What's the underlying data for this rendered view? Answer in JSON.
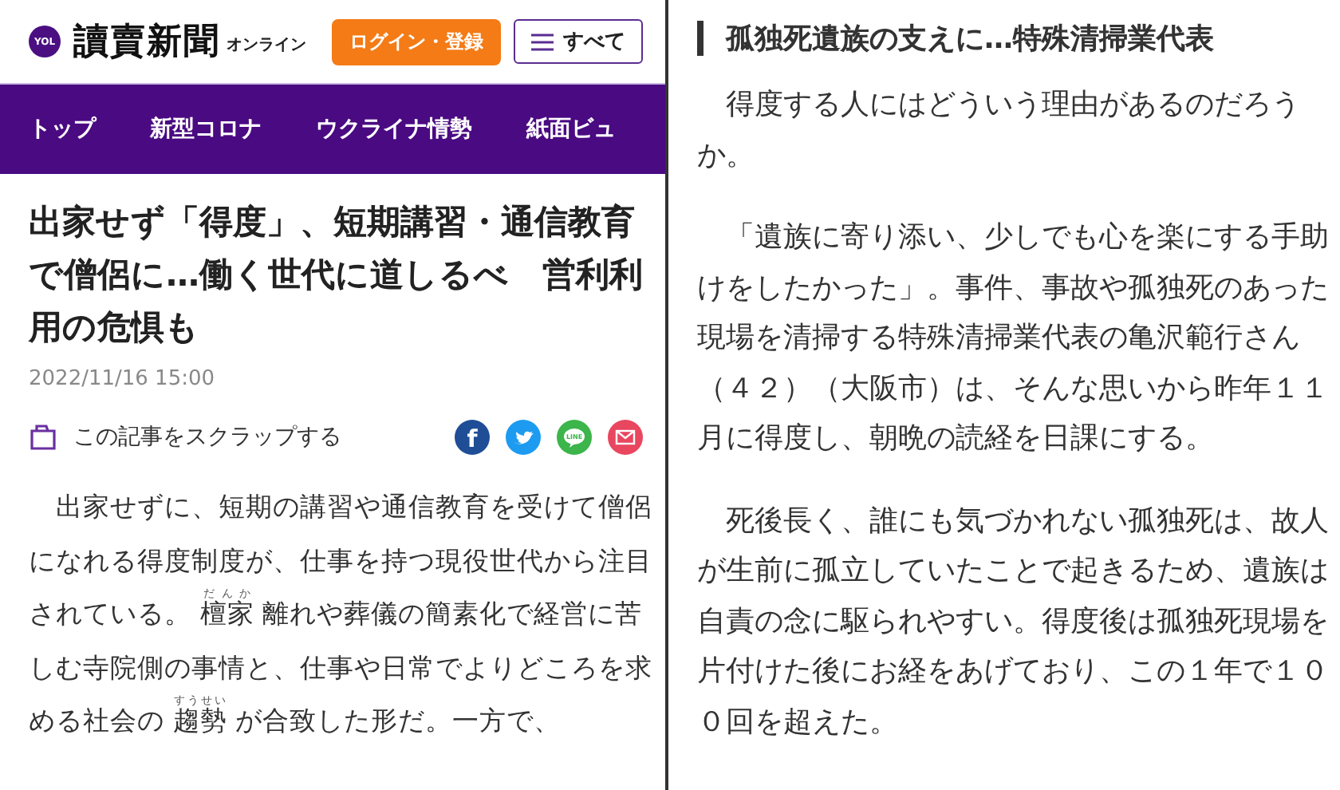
{
  "left": {
    "header": {
      "logo_badge": "YOL",
      "logo": "讀賣新聞",
      "logo_suffix": "オンライン",
      "login_button": "ログイン・登録",
      "menu_button": "すべて"
    },
    "nav": [
      {
        "label": "トップ"
      },
      {
        "label": "新型コロナ"
      },
      {
        "label": "ウクライナ情勢"
      },
      {
        "label": "紙面ビュ"
      }
    ],
    "headline": "出家せず「得度」、短期講習・通信教育で僧侶に…働く世代に道しるべ　営利利用の危惧も",
    "date": "2022/11/16 15:00",
    "scrap_link": "この記事をスクラップする",
    "share": [
      {
        "kind": "facebook",
        "label": "f",
        "color": "#1f4e96"
      },
      {
        "kind": "twitter",
        "color": "#1d9bf0"
      },
      {
        "kind": "line",
        "label": "LINE",
        "color": "#3cb54a"
      },
      {
        "kind": "mail",
        "color": "#e8475f"
      }
    ],
    "body": [
      {
        "text": "　出家せずに、短期の講習や通信教育を受けて僧侶になれる得度制度が、仕事を持つ現役世代から注目されている。 "
      },
      {
        "base": "檀家",
        "reading": "だんか"
      },
      {
        "text": " 離れや葬儀の簡素化で経営に苦しむ寺院側の事情と、仕事や日常でよりどころを求める社会の "
      },
      {
        "base": "趨勢",
        "reading": "すうせい"
      },
      {
        "text": " が合致した形だ。一方で、"
      }
    ]
  },
  "right": {
    "section_title": "孤独死遺族の支えに…特殊清掃業代表",
    "paragraphs": [
      "　得度する人にはどういう理由があるのだろうか。",
      "　「遺族に寄り添い、少しでも心を楽にする手助けをしたかった」。事件、事故や孤独死のあった現場を清掃する特殊清掃業代表の亀沢範行さん（４２）（大阪市）は、そんな思いから昨年１１月に得度し、朝晩の読経を日課にする。",
      "　死後長く、誰にも気づかれない孤独死は、故人が生前に孤立していたことで起きるため、遺族は自責の念に駆られやすい。得度後は孤独死現場を片付けた後にお経をあげており、この１年で１００回を超えた。"
    ]
  }
}
